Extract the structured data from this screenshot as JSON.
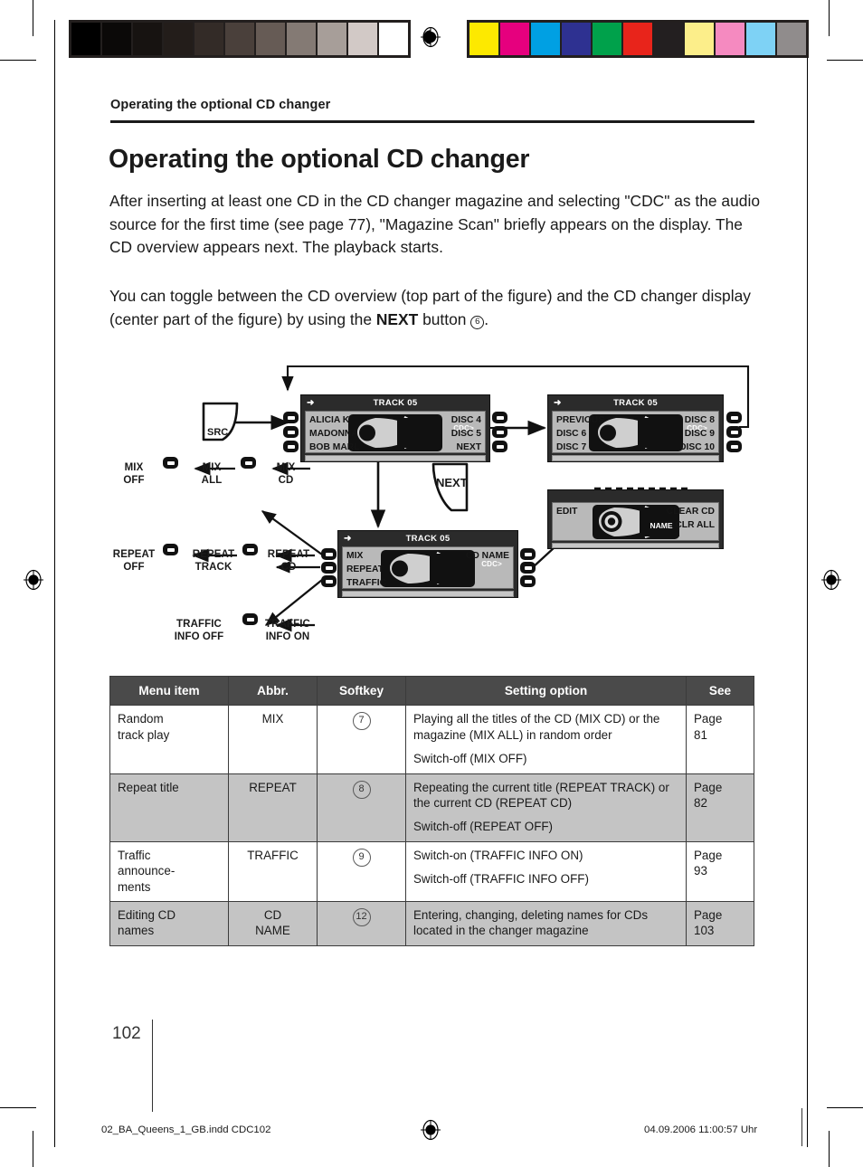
{
  "runninghead": "Operating the optional CD changer",
  "title": "Operating the optional CD changer",
  "paragraphs": {
    "p1": "After inserting at least one CD in the CD changer magazine and selecting \"CDC\" as the audio source for the first time (see page 77), \"Magazine Scan\" briefly appears on the display. The CD overview appears next. The playback starts.",
    "p2_a": "You can toggle between the CD overview (top part of the figure) and the CD changer display (center part of the figure) by using the ",
    "p2_bold": "NEXT",
    "p2_b": " button ",
    "p2_circled": "6",
    "p2_c": "."
  },
  "diagram": {
    "src_key_label": "SRC",
    "next_key_label": "NEXT",
    "cone_label": "CDC>",
    "panel_top_left": {
      "title": "TRACK 05",
      "left_items": [
        "ALICIA K",
        "MADONNA",
        "BOB MARL"
      ],
      "right_items": [
        "DISC 4",
        "DISC 5",
        "NEXT"
      ]
    },
    "panel_top_right": {
      "title": "TRACK 05",
      "left_items": [
        "PREVIOUS",
        "DISC 6",
        "DISC 7"
      ],
      "right_items": [
        "DISC 8",
        "DISC 9",
        "DISC 10"
      ]
    },
    "panel_center": {
      "title": "TRACK 05",
      "left_items": [
        "MIX",
        "REPEAT",
        "TRAFFIC"
      ],
      "right_items": [
        "CD NAME"
      ]
    },
    "panel_edit": {
      "left_items": [
        "EDIT"
      ],
      "right_items": [
        "CLEAR CD",
        "CLR ALL"
      ],
      "disc_label": "NAME"
    },
    "chains": {
      "mix": [
        "MIX\nOFF",
        "MIX\nALL",
        "MIX\nCD"
      ],
      "mix_l1": [
        "MIX",
        "MIX",
        "MIX"
      ],
      "mix_l2": [
        "OFF",
        "ALL",
        "CD"
      ],
      "repeat_l1": [
        "REPEAT",
        "REPEAT",
        "REPEAT"
      ],
      "repeat_l2": [
        "OFF",
        "TRACK",
        "CD"
      ],
      "traffic_l1": [
        "TRAFFIC",
        "TRAFFIC"
      ],
      "traffic_l2": [
        "INFO OFF",
        "INFO ON"
      ]
    }
  },
  "table": {
    "headers": [
      "Menu item",
      "Abbr.",
      "Softkey",
      "Setting option",
      "See"
    ],
    "rows": [
      {
        "menu_item": "Random track play",
        "abbr": "MIX",
        "softkey": "7",
        "options": [
          "Playing all the titles of the CD (MIX CD) or the magazine (MIX ALL) in random order",
          "Switch-off (MIX OFF)"
        ],
        "see": "Page 81"
      },
      {
        "menu_item": "Repeat title",
        "abbr": "REPEAT",
        "softkey": "8",
        "options": [
          "Repeating the current title (REPEAT TRACK) or the current CD (REPEAT CD)",
          "Switch-off (REPEAT OFF)"
        ],
        "see": "Page 82"
      },
      {
        "menu_item": "Traffic announce-ments",
        "abbr": "TRAFFIC",
        "softkey": "9",
        "options": [
          "Switch-on (TRAFFIC INFO ON)",
          "Switch-off (TRAFFIC INFO OFF)"
        ],
        "see": "Page 93"
      },
      {
        "menu_item": "Editing CD names",
        "abbr": "CD NAME",
        "softkey": "12",
        "options": [
          "Entering, changing, deleting names for CDs located in the changer magazine"
        ],
        "see": "Page 103"
      }
    ]
  },
  "footer": {
    "page_number": "102",
    "file": "02_BA_Queens_1_GB.indd  CDC102",
    "date": "04.09.2006   11:00:57 Uhr"
  },
  "calibration": {
    "gray": [
      "#000000",
      "#0b0908",
      "#171311",
      "#231d1a",
      "#332b27",
      "#4a403b",
      "#665b55",
      "#847a74",
      "#a79e99",
      "#d2c9c6",
      "#ffffff"
    ],
    "color": [
      "#fde900",
      "#e6007e",
      "#00a0e3",
      "#2e3191",
      "#00a14b",
      "#e8241b",
      "#231f20",
      "#fcee8a",
      "#f58ac0",
      "#7ed2f5",
      "#908c8c"
    ]
  }
}
